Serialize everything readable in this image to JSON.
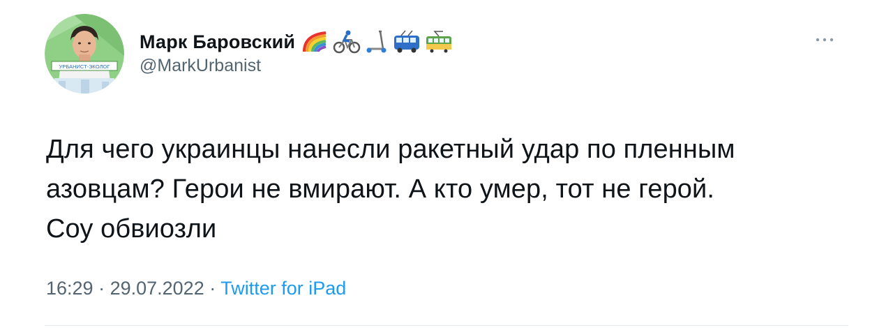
{
  "author": {
    "display_name": "Марк Баровский",
    "handle": "@MarkUrbanist",
    "avatar_badge_text": "УРБАНИСТ-ЭКОЛОГ",
    "name_emojis": [
      "rainbow-icon",
      "cyclist-icon",
      "kick-scooter-icon",
      "bus-icon",
      "tram-icon"
    ]
  },
  "more_button": {
    "label": "···"
  },
  "tweet": {
    "text": "Для чего украинцы нанесли ракетный удар по пленным\nазовцам? Герои не вмирают. А кто умер, тот не герой.\nСоу обвиозли"
  },
  "meta": {
    "time": "16:29",
    "separator": " · ",
    "date": "29.07.2022",
    "source": "Twitter for iPad"
  },
  "colors": {
    "text_primary": "#0f1419",
    "text_secondary": "#536471",
    "accent": "#1d9bf0",
    "divider": "#e6ecf0"
  }
}
